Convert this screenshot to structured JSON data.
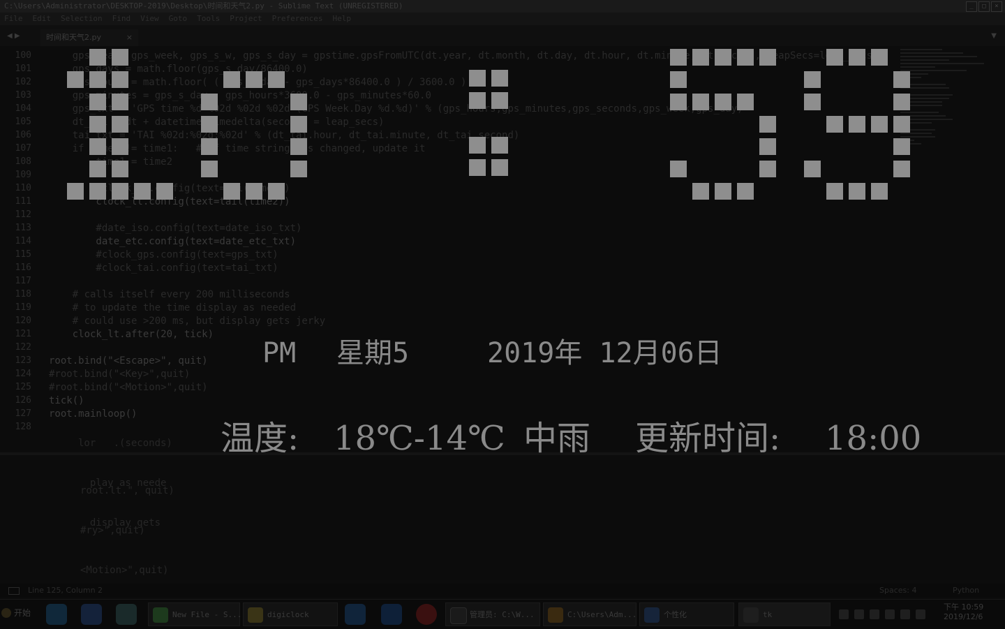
{
  "window": {
    "title": "C:\\Users\\Administrator\\DESKTOP-2019\\Desktop\\时间和天气2.py - Sublime Text (UNREGISTERED)",
    "controls": [
      "_",
      "□",
      "×"
    ]
  },
  "menu": [
    "File",
    "Edit",
    "Selection",
    "Find",
    "View",
    "Goto",
    "Tools",
    "Project",
    "Preferences",
    "Help"
  ],
  "tabs": {
    "active": "时间和天气2.py",
    "close": "×",
    "nav": "◀ ▶",
    "overflow": "▼"
  },
  "editor": {
    "line_numbers": [
      "100",
      "101",
      "102",
      "103",
      "104",
      "105",
      "106",
      "107",
      "108",
      "109",
      "110",
      "111",
      "112",
      "113",
      "114",
      "115",
      "116",
      "117",
      "118",
      "119",
      "120",
      "121",
      "122",
      "123",
      "124",
      "125",
      "126",
      "127",
      "128"
    ],
    "lines": [
      "    gps_year, gps_week, gps_s_w, gps_s_day = gpstime.gpsFromUTC(dt.year, dt.month, dt.day, dt.hour, dt.minute, dt.second, leapSecs=leap_secs)",
      "    gps_days = math.floor(gps_s_day/86400.0)",
      "    gps_hours = math.floor( ( gps_s_day - gps_days*86400.0 ) / 3600.0 )",
      "    gps_minutes = gps_s_day - gps_hours*3600.0 - gps_minutes*60.0",
      "    gps_txt = 'GPS time %d %02d %02d %02d (GPS Week.Day %d.%d)' % (gps_hours,gps_minutes,gps_seconds,gps_week,gps_day)",
      "    dt_tai = dt + datetime.timedelta(seconds = leap_secs)",
      "    tai_txt = 'TAI %02d:%02d:%02d' % (dt_tai.hour, dt_tai.minute, dt_tai.second)",
      "    if time2 != time1:   # if time string has changed, update it",
      "        time1 = time2",
      "",
      "        #clock_lt.config(text=tai(time2))",
      "        clock_lt.config(text=tail(time2))",
      "",
      "        #date_iso.config(text=date_iso_txt)",
      "        date_etc.config(text=date_etc_txt)",
      "        #clock_gps.config(text=gps_txt)",
      "        #clock_tai.config(text=tai_txt)",
      "",
      "    # calls itself every 200 milliseconds",
      "    # to update the time display as needed",
      "    # could use >200 ms, but display gets jerky",
      "    clock_lt.after(20, tick)",
      "",
      "root.bind(\"<Escape>\", quit)",
      "#root.bind(\"<Key>\",quit)",
      "#root.bind(\"<Motion>\",quit)",
      "tick()",
      "root.mainloop()",
      ""
    ],
    "ghost_lines": [
      "lor   .(seconds)",
      "  play as neede",
      "  display gets"
    ],
    "ghost_lines2": [
      "root.lt.\", quit)",
      "#ry>\",quit)",
      "<Motion>\",quit)"
    ]
  },
  "status": {
    "position": "Line 125, Column 2",
    "spaces": "Spaces: 4",
    "syntax": "Python"
  },
  "taskbar": {
    "start": "开始",
    "tasks": [
      {
        "label": "New File - S...",
        "color": "#1d3a1d"
      },
      {
        "label": "digiclock",
        "color": "#3a3416"
      },
      {
        "label": "管理员: C:\\W...",
        "color": "#161616"
      },
      {
        "label": "C:\\Users\\Adm...",
        "color": "#3a2a10"
      },
      {
        "label": "个性化",
        "color": "#16243a"
      },
      {
        "label": "tk",
        "color": "#1e1e1e"
      }
    ],
    "tray_time": "下午 10:59",
    "tray_date": "2019/12/6"
  },
  "overlay": {
    "time_digits": [
      "1",
      "0",
      "5",
      "9"
    ],
    "ampm": "PM",
    "weekday": "星期5",
    "date": "2019年 12月06日",
    "weather_label": "温度:",
    "temperature": "18℃-14℃",
    "condition": "中雨",
    "update_label": "更新时间:",
    "update_time": "18:00",
    "color": "#8e8e8e"
  }
}
